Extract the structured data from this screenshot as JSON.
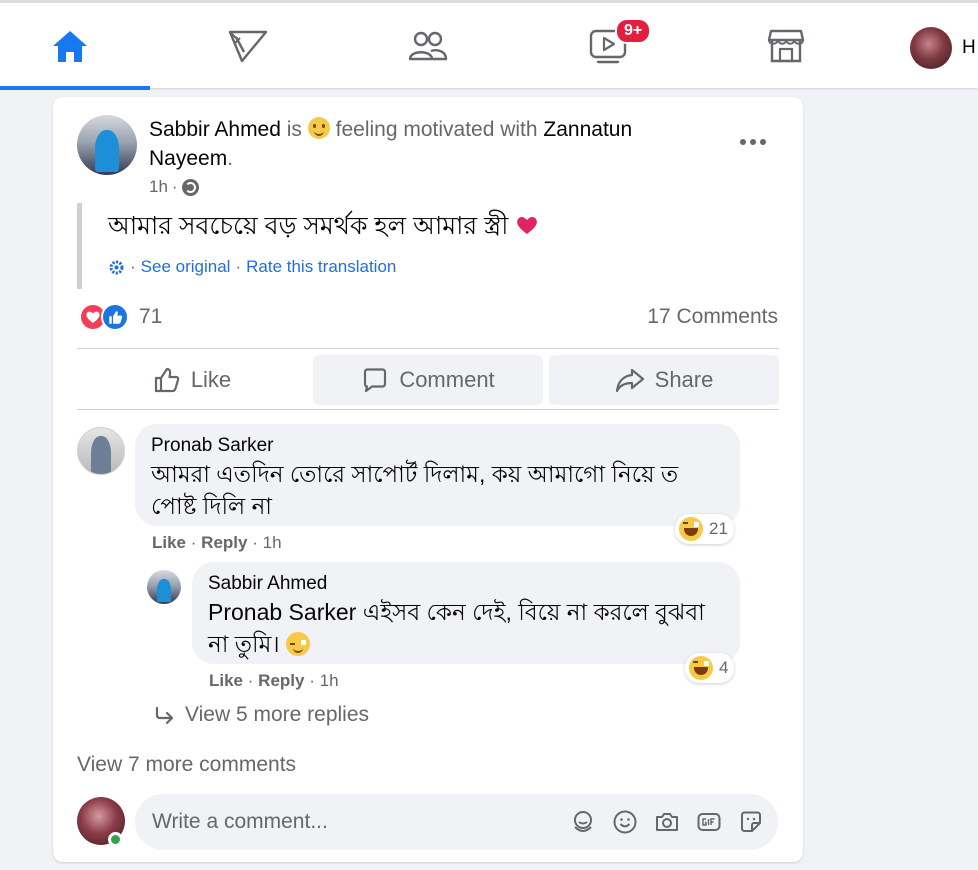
{
  "nav": {
    "items": [
      {
        "name": "home",
        "icon": "home-icon",
        "active": true
      },
      {
        "name": "pages",
        "icon": "flag-icon"
      },
      {
        "name": "groups",
        "icon": "groups-icon"
      },
      {
        "name": "watch",
        "icon": "video-icon",
        "badge": "9+"
      },
      {
        "name": "marketplace",
        "icon": "marketplace-icon"
      }
    ],
    "profile_initial": "H",
    "accent": "#1877f2",
    "badge_color": "#e41e3f"
  },
  "post": {
    "author": "Sabbir Ahmed",
    "is_text": "is",
    "feeling_text": "feeling motivated with",
    "tagged": "Zannatun Nayeem",
    "period": ".",
    "time": "1h",
    "body": "আমার সবচেয়ে বড় সমর্থক হল আমার স্ত্রী",
    "see_original": "See original",
    "separator": "·",
    "rate_translation": "Rate this translation",
    "reaction_count": "71",
    "comments_count": "17 Comments",
    "actions": {
      "like": "Like",
      "comment": "Comment",
      "share": "Share"
    }
  },
  "comments": [
    {
      "author": "Pronab Sarker",
      "body": "আমরা এতদিন তোরে সাপোর্ট দিলাম, কয় আমাগো নিয়ে ত পোষ্ট দিলি না",
      "reaction_count": "21",
      "like": "Like",
      "reply": "Reply",
      "time": "1h"
    }
  ],
  "reply": {
    "author": "Sabbir Ahmed",
    "mention": "Pronab Sarker",
    "body": "এইসব কেন দেই, বিয়ে না করলে বুঝবা না তুমি।",
    "reaction_count": "4",
    "like": "Like",
    "reply": "Reply",
    "time": "1h"
  },
  "view_more_replies": "View 5 more replies",
  "view_more_comments": "View 7 more comments",
  "composer": {
    "placeholder": "Write a comment..."
  }
}
